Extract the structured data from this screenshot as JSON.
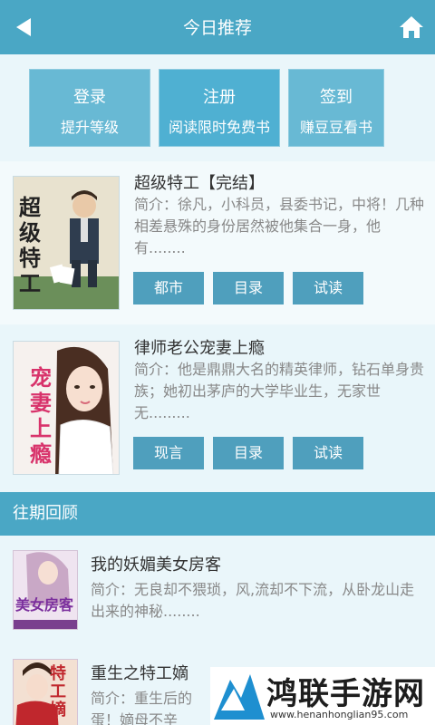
{
  "header": {
    "title": "今日推荐",
    "back_icon": "back-arrow-icon",
    "home_icon": "home-icon"
  },
  "actions": [
    {
      "label": "登录",
      "sub": "提升等级"
    },
    {
      "label": "注册",
      "sub": "阅读限时免费书"
    },
    {
      "label": "签到",
      "sub": "赚豆豆看书"
    }
  ],
  "books": [
    {
      "title": "超级特工【完结】",
      "intro": "简介：徐凡，小科员，县委书记，中将！几种相差悬殊的身份居然被他集合一身，他有........",
      "cover_text": "超级特工",
      "buttons": [
        "都市",
        "目录",
        "试读"
      ]
    },
    {
      "title": "律师老公宠妻上瘾",
      "intro": "简介：他是鼎鼎大名的精英律师，钻石单身贵族；她初出茅庐的大学毕业生，无家世无.........",
      "cover_text": "宠妻上瘾",
      "buttons": [
        "现言",
        "目录",
        "试读"
      ]
    }
  ],
  "section": {
    "title": "往期回顾"
  },
  "reviews": [
    {
      "title": "我的妖媚美女房客",
      "intro": "简介：无良却不猥琐，风,流却不下流，从卧龙山走出来的神秘........",
      "cover_text": "美女房客"
    },
    {
      "title": "重生之特工嫡",
      "intro": "简介：重生后的蛋！嫡母不辛",
      "cover_text": "特工嫡"
    }
  ],
  "watermark": {
    "name": "鸿联手游网",
    "url": "www.henanhonglian95.com"
  },
  "colors": {
    "header": "#4aa7c5",
    "button": "#4f9fbd",
    "background": "#eaf6fa"
  }
}
